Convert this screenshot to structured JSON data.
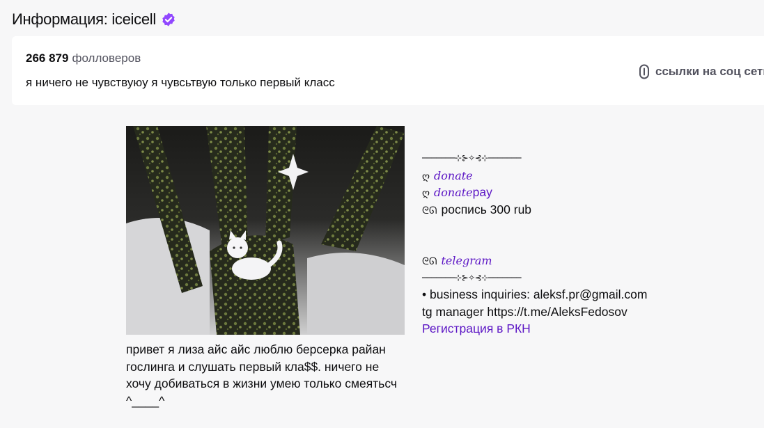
{
  "header": {
    "title": "Информация: iceicell",
    "verified_color": "#9147ff"
  },
  "info_card": {
    "followers_count": "266 879",
    "followers_label": "фолловеров",
    "bio": "я ничего не чувствуюу я чувсьтвую только первый класс",
    "social_label": "ссылки на соц сети",
    "social_icon": "link-icon"
  },
  "image_panel": {
    "description": "привет я лиза айс айс люблю берсерка райан гослинга и слушать первый кла$$. ничего не хочу добиваться в жизни умею только смеятьсч ^____^"
  },
  "links_panel": {
    "divider_top": "───────⊹⊱✧⊰⊹───────",
    "donate_glyph": "ღ",
    "donate_label": "donate",
    "donatepay_glyph": "ღ",
    "donatepay_prefix": "donate",
    "donatepay_suffix": "pay",
    "signature_glyph": "ᘓᘏ",
    "signature_text": "роспись 300 rub",
    "telegram_glyph": "ᘓᘏ",
    "telegram_label": "telegram",
    "divider_bottom": "───────⊹⊱✧⊰⊹───────",
    "business_line": "• business inquiries: aleksf.pr@gmail.com",
    "manager_line": "tg manager https://t.me/AleksFedosov",
    "rkn_link": "Регистрация в РКН"
  },
  "colors": {
    "accent": "#9147ff",
    "link": "#5c16c5",
    "background": "#f7f7f8",
    "card": "#ffffff"
  }
}
